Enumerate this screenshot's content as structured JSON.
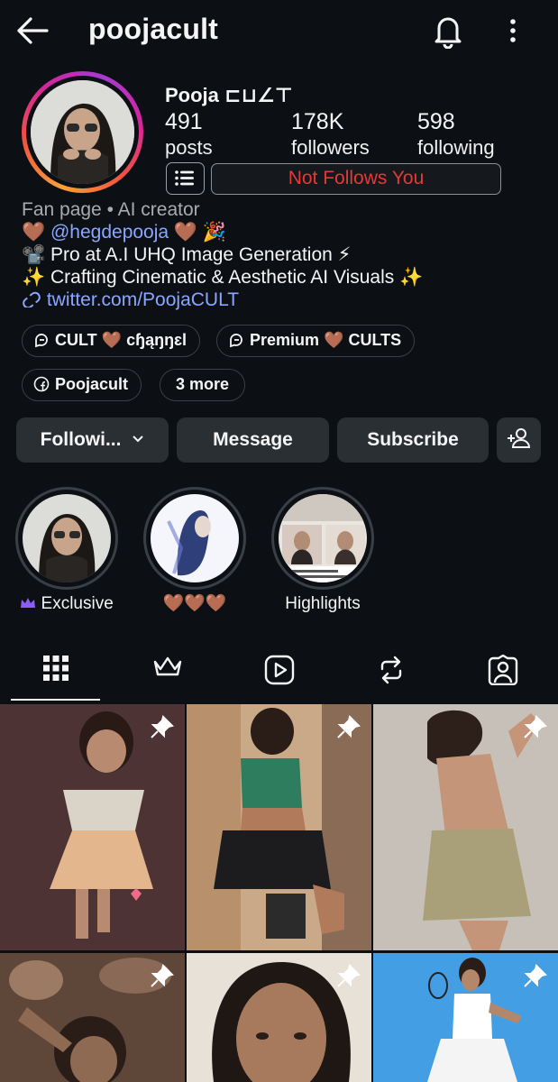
{
  "header": {
    "username": "poojacult"
  },
  "profile": {
    "display_name": "Pooja ꓕ⅃Ꞁ⊏",
    "display_name_glyph": "Pooja ⊏⊔∠⊤",
    "stats": [
      {
        "value": "491",
        "label": "posts"
      },
      {
        "value": "178K",
        "label": "followers"
      },
      {
        "value": "598",
        "label": "following"
      }
    ],
    "relationship": "Not Follows You"
  },
  "bio": {
    "category": "Fan page • AI creator",
    "line1_pre": "🤎 ",
    "mention": "@hegdepooja",
    "line1_post": " 🤎 🎉",
    "line2": "📽️ Pro at A.I UHQ Image Generation ⚡",
    "line3": "✨ Crafting Cinematic & Aesthetic AI Visuals ✨",
    "link": "twitter.com/PoojaCULT"
  },
  "chips": [
    {
      "label": "CULT 🤎 cɧąŋŋɛl"
    },
    {
      "label": "Premium 🤎 CULTS"
    },
    {
      "label": "Poojacult"
    },
    {
      "label": "3 more"
    }
  ],
  "actions": {
    "following": "Followi...",
    "message": "Message",
    "subscribe": "Subscribe"
  },
  "highlights": [
    {
      "label": "Exclusive"
    },
    {
      "label": "🤎🤎🤎"
    },
    {
      "label": "Highlights"
    }
  ],
  "colors": {
    "background": "#0c1014",
    "button": "#2a2f34",
    "link": "#8aa7ff",
    "warning": "#e53935",
    "exclusive_crown": "#8b5cf6"
  }
}
